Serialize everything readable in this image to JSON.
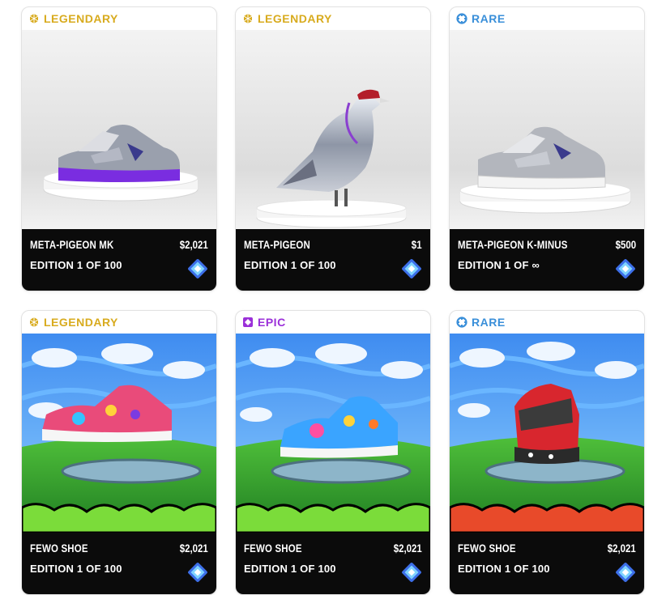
{
  "colors": {
    "legendary": "#d8ab1e",
    "rare": "#3a8fd9",
    "epic": "#9b30d9"
  },
  "cards": [
    {
      "rarity": "LEGENDARY",
      "name": "META-PIGEON MK",
      "price": "$2,021",
      "edition": "EDITION 1 OF 100",
      "image": "purple-silver-sneaker-on-pedestal",
      "logo_icon": "rtfkt-logo-icon"
    },
    {
      "rarity": "LEGENDARY",
      "name": "META-PIGEON",
      "price": "$1",
      "edition": "EDITION 1 OF 100",
      "image": "chrome-robot-pigeon-on-pedestal",
      "logo_icon": "rtfkt-logo-icon"
    },
    {
      "rarity": "RARE",
      "name": "META-PIGEON K-MINUS",
      "price": "$500",
      "edition": "EDITION 1 OF ∞",
      "image": "white-silver-sneaker-on-pedestal",
      "logo_icon": "rtfkt-logo-icon"
    },
    {
      "rarity": "LEGENDARY",
      "name": "FEWO SHOE",
      "price": "$2,021",
      "edition": "EDITION 1 OF 100",
      "image": "colorful-sneaker-cartoon-landscape",
      "logo_icon": "rtfkt-logo-icon"
    },
    {
      "rarity": "EPIC",
      "name": "FEWO SHOE",
      "price": "$2,021",
      "edition": "EDITION 1 OF 100",
      "image": "rainbow-sneaker-cartoon-landscape",
      "logo_icon": "rtfkt-logo-icon"
    },
    {
      "rarity": "RARE",
      "name": "FEWO SHOE",
      "price": "$2,021",
      "edition": "EDITION 1 OF 100",
      "image": "red-sneaker-cartoon-landscape",
      "logo_icon": "rtfkt-logo-icon"
    }
  ]
}
